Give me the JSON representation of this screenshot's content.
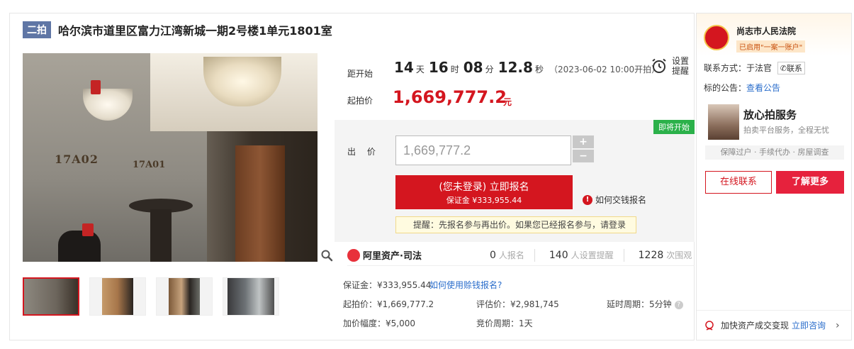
{
  "header": {
    "round_tag": "二拍",
    "title": "哈尔滨市道里区富力江湾新城一期2号楼1单元1801室"
  },
  "photo": {
    "sign1": "17A02",
    "sign2": "17A01",
    "zoom_icon": "magnifier-icon"
  },
  "countdown": {
    "label": "距开始",
    "days": "14",
    "days_unit": "天",
    "hours": "16",
    "hours_unit": "时",
    "minutes": "08",
    "minutes_unit": "分",
    "seconds": "12.8",
    "seconds_unit": "秒",
    "start_text": "（2023-06-02 10:00开拍）",
    "remind_label": "设置提醒",
    "remind_icon": "alarm-clock-icon"
  },
  "price": {
    "start_label": "起拍价",
    "start_value": "1,669,777.2",
    "unit": "元"
  },
  "bid": {
    "soon_badge": "即将开始",
    "label": "出  价",
    "input_placeholder": "1,669,777.2",
    "plus": "+",
    "minus": "−",
    "signup_main": "(您未登录) 立即报名",
    "signup_sub": "保证金 ¥333,955.44",
    "howto": "如何交钱报名",
    "tip": "提醒：先报名参与再出价。如果您已经报名参与，请登录"
  },
  "stats": {
    "brand": "阿里资产·司法",
    "signups": "0",
    "signups_label": "人报名",
    "reminders": "140",
    "reminders_label": "人设置提醒",
    "views": "1228",
    "views_label": "次围观"
  },
  "details": {
    "deposit": "保证金：¥333,955.44",
    "deposit_link": "如何使用赊钱报名?",
    "start_price": "起拍价：¥1,669,777.2",
    "valuation": "评估价：¥2,981,745",
    "extend": "延时周期：5分钟",
    "increment": "加价幅度：¥5,000",
    "cycle": "竞价周期：1天"
  },
  "side": {
    "court_name": "尚志市人民法院",
    "court_badge": "已启用\"一案一账户\"",
    "contact_label": "联系方式：于法官",
    "contact_btn": "联系",
    "notice_label": "标的公告：",
    "notice_link": "查看公告",
    "service_title": "放心拍服务",
    "service_sub": "拍卖平台服务，全程无忧",
    "service_strip": "保障过户 · 手续代办 · 房屋调查",
    "btn_online": "在线联系",
    "btn_more": "了解更多",
    "footer_text": "加快资产成交变现",
    "footer_link": "立即咨询"
  },
  "colors": {
    "accent_red": "#d4161f",
    "tag_blue": "#5f76a5",
    "link_blue": "#2a6dcb",
    "green_badge": "#2bb14a"
  }
}
